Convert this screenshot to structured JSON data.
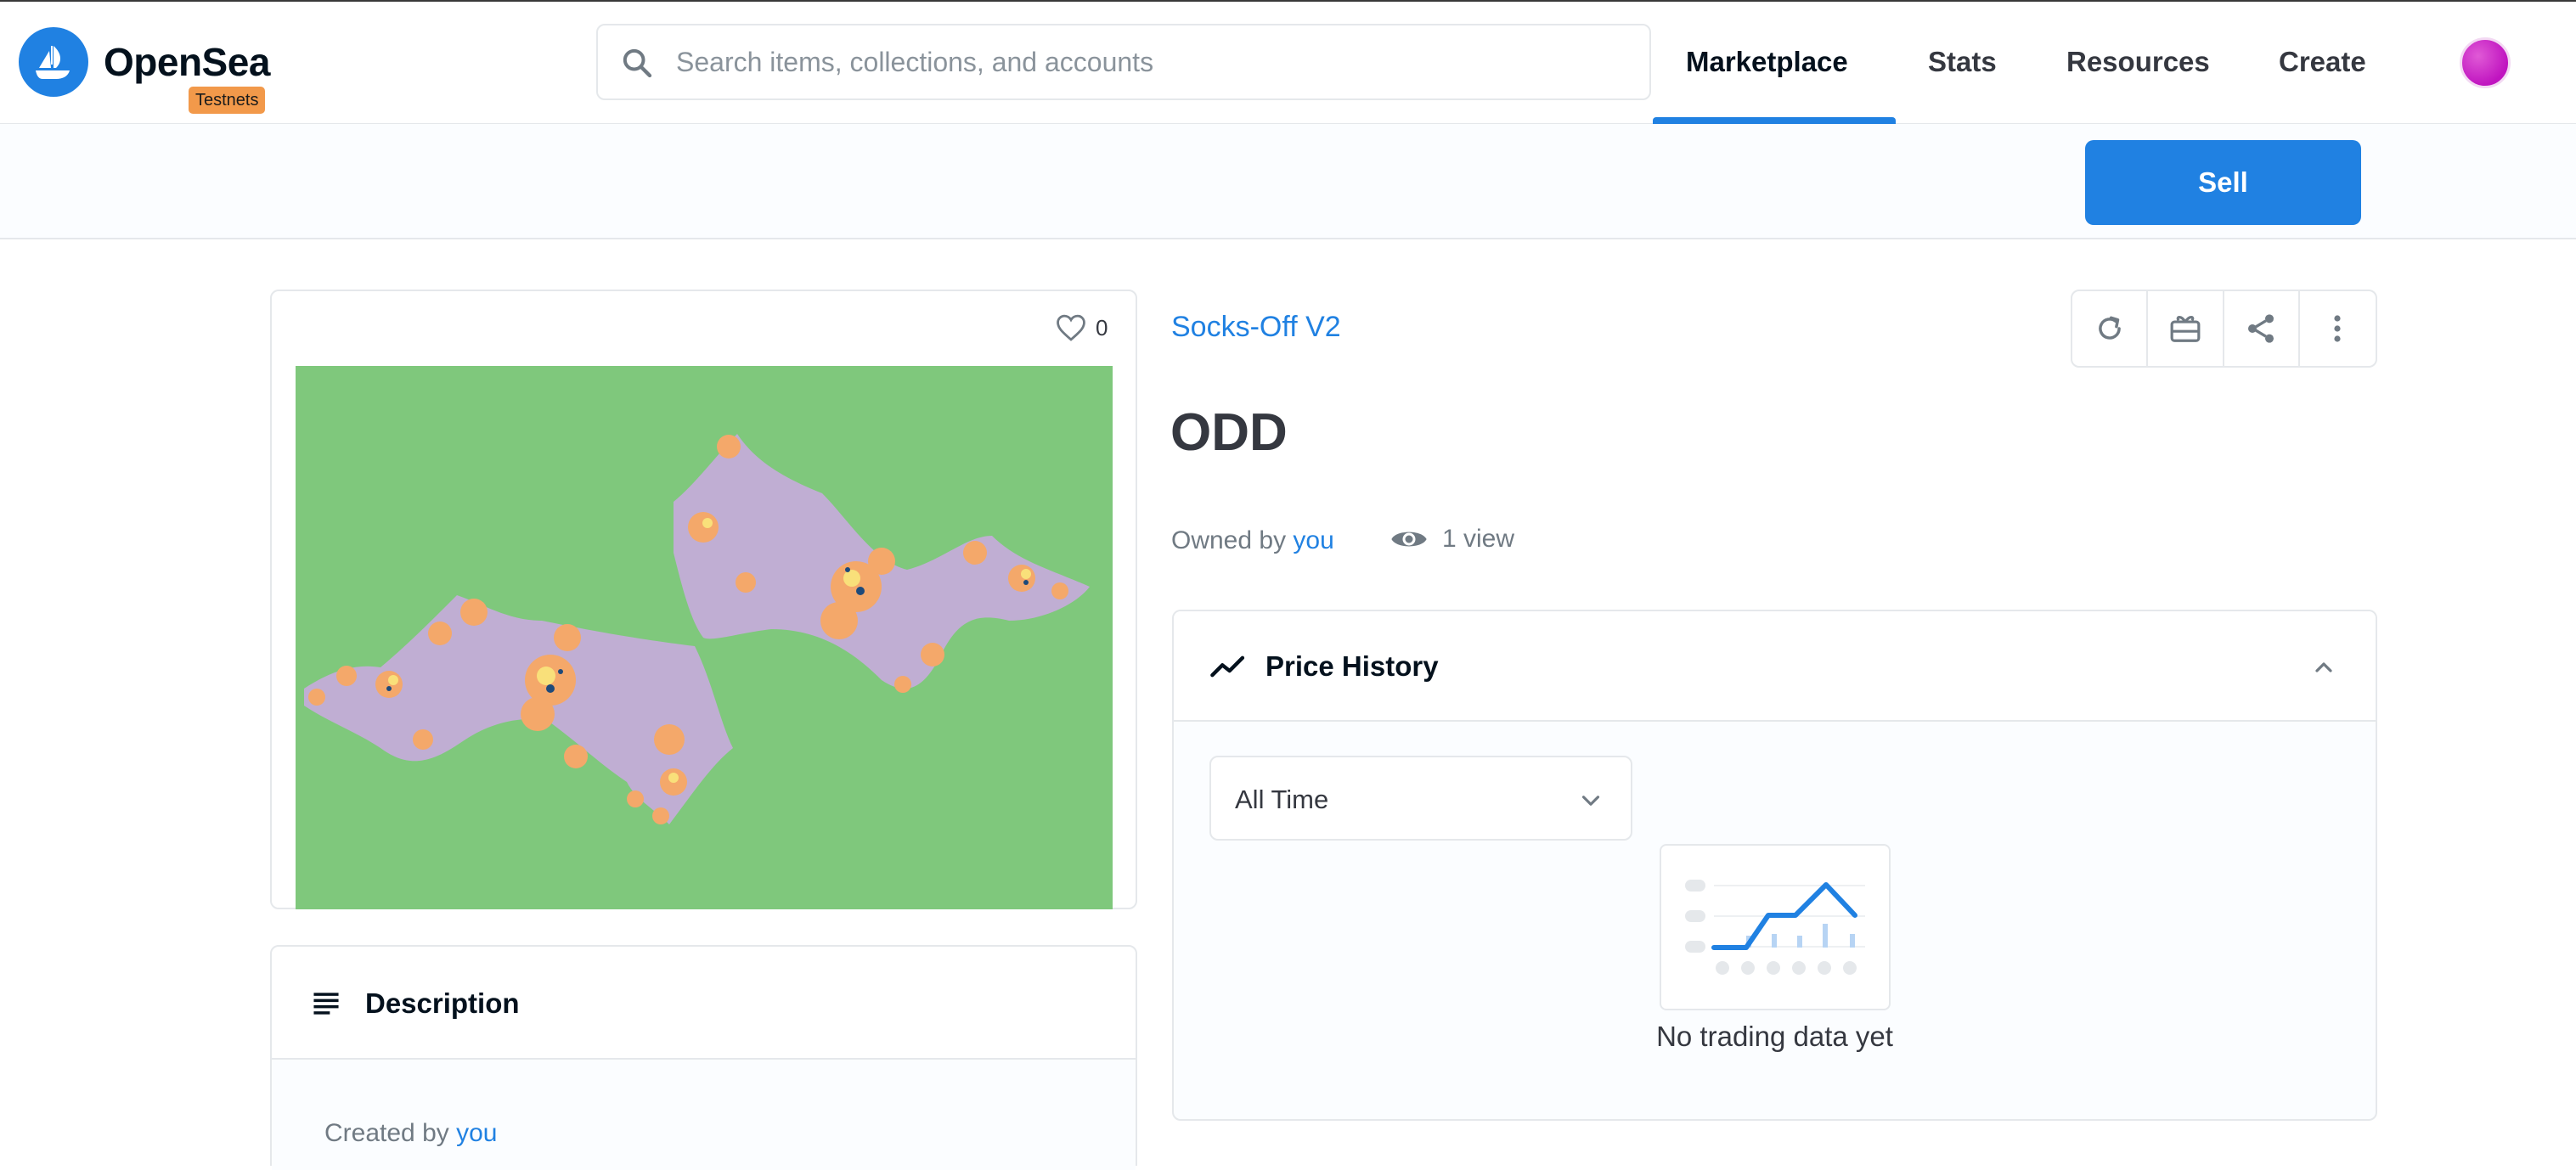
{
  "header": {
    "brand": "OpenSea",
    "badge": "Testnets",
    "search_placeholder": "Search items, collections, and accounts",
    "nav": [
      "Marketplace",
      "Stats",
      "Resources",
      "Create"
    ],
    "active_nav": "Marketplace"
  },
  "action_bar": {
    "sell_label": "Sell"
  },
  "asset": {
    "favorites": "0",
    "collection": "Socks-Off V2",
    "title": "ODD",
    "owned_prefix": "Owned by",
    "owner": "you",
    "views": "1 view"
  },
  "description": {
    "title": "Description",
    "created_prefix": "Created by",
    "creator": "you"
  },
  "price_history": {
    "title": "Price History",
    "range_selected": "All Time",
    "empty_text": "No trading data yet"
  },
  "colors": {
    "accent": "#2081e2",
    "badge": "#f2994a",
    "art_background": "#7fc87c",
    "art_shape": "#c0aed3",
    "art_detail": "#f4a86a"
  },
  "icons": [
    "search-icon",
    "heart-icon",
    "refresh-icon",
    "gift-icon",
    "share-icon",
    "more-vertical-icon",
    "eye-icon",
    "description-icon",
    "trending-icon",
    "chevron-up-icon",
    "chevron-down-icon"
  ]
}
